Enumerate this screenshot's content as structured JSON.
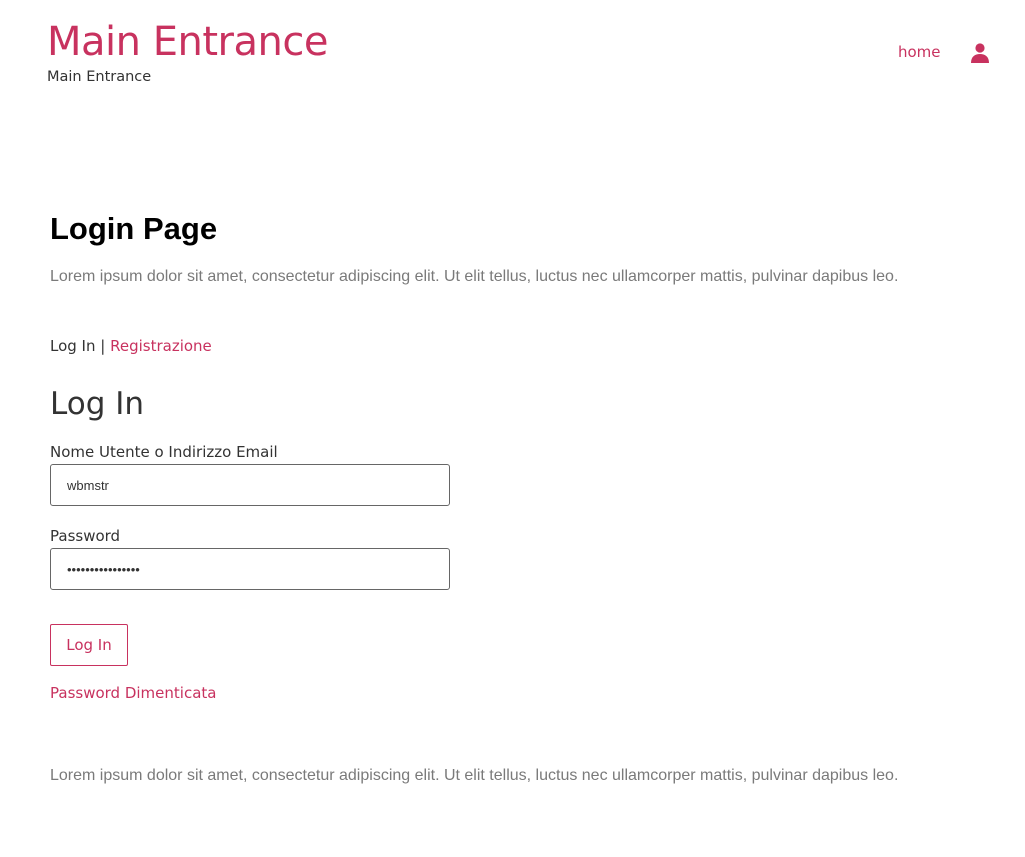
{
  "header": {
    "site_title": "Main Entrance",
    "tagline": "Main Entrance",
    "nav": {
      "home_label": "home"
    },
    "icons": {
      "account": "user-icon"
    }
  },
  "main": {
    "page_heading": "Login Page",
    "intro_text": "Lorem ipsum dolor sit amet, consectetur adipiscing elit. Ut elit tellus, luctus nec ullamcorper mattis, pulvinar dapibus leo.",
    "tabs": {
      "login_label": "Log In",
      "separator": " | ",
      "register_label": "Registrazione"
    },
    "form": {
      "heading": "Log In",
      "username_label": "Nome Utente o Indirizzo Email",
      "username_value": "wbmstr",
      "password_label": "Password",
      "password_value": "••••••••••••••••",
      "submit_label": "Log In",
      "forgot_label": "Password Dimenticata"
    },
    "outro_text": "Lorem ipsum dolor sit amet, consectetur adipiscing elit. Ut elit tellus, luctus nec ullamcorper mattis, pulvinar dapibus leo."
  },
  "colors": {
    "accent": "#c8325f",
    "text": "#333333",
    "muted_text": "#7a7a7a",
    "heading": "#000000"
  }
}
